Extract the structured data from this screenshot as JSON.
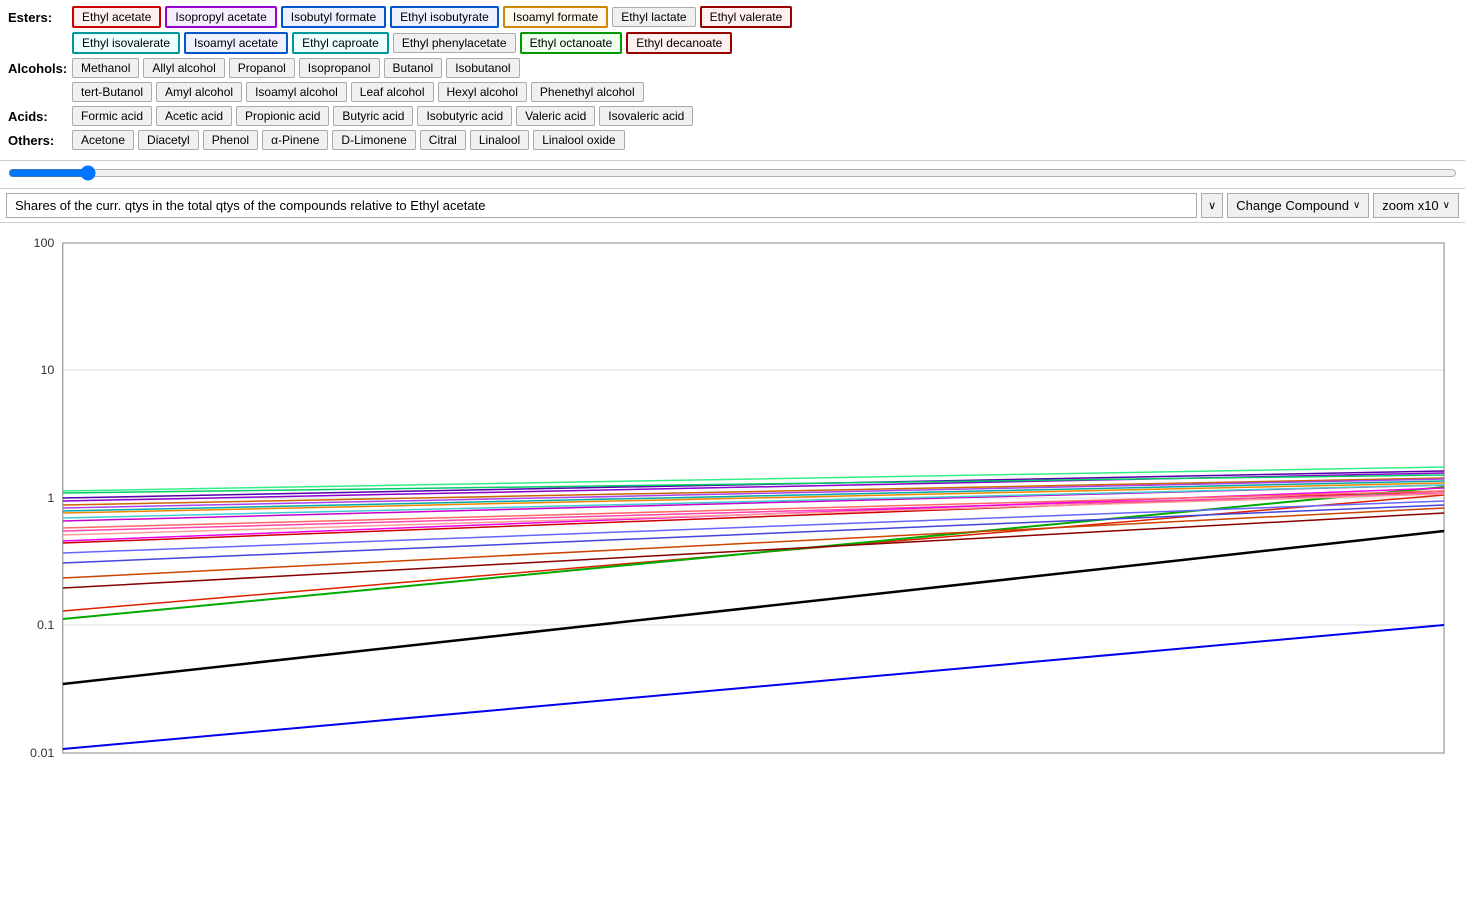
{
  "categories": [
    {
      "label": "Esters:",
      "compounds": [
        {
          "name": "Ethyl acetate",
          "style": "selected-red"
        },
        {
          "name": "Isopropyl acetate",
          "style": "selected-purple"
        },
        {
          "name": "Isobutyl formate",
          "style": "selected-blue"
        },
        {
          "name": "Ethyl isobutyrate",
          "style": "selected-blue"
        },
        {
          "name": "Isoamyl formate",
          "style": "selected-orange"
        },
        {
          "name": "Ethyl lactate",
          "style": ""
        },
        {
          "name": "Ethyl valerate",
          "style": "selected-darkred"
        }
      ]
    },
    {
      "label": "",
      "compounds": [
        {
          "name": "Ethyl isovalerate",
          "style": "selected-cyan"
        },
        {
          "name": "Isoamyl acetate",
          "style": "selected-blue"
        },
        {
          "name": "Ethyl caproate",
          "style": "selected-cyan"
        },
        {
          "name": "Ethyl phenylacetate",
          "style": ""
        },
        {
          "name": "Ethyl octanoate",
          "style": "selected-green"
        },
        {
          "name": "Ethyl decanoate",
          "style": "selected-darkred"
        }
      ]
    },
    {
      "label": "Alcohols:",
      "compounds": [
        {
          "name": "Methanol",
          "style": ""
        },
        {
          "name": "Allyl alcohol",
          "style": ""
        },
        {
          "name": "Propanol",
          "style": ""
        },
        {
          "name": "Isopropanol",
          "style": ""
        },
        {
          "name": "Butanol",
          "style": ""
        },
        {
          "name": "Isobutanol",
          "style": ""
        }
      ]
    },
    {
      "label": "",
      "compounds": [
        {
          "name": "tert-Butanol",
          "style": ""
        },
        {
          "name": "Amyl alcohol",
          "style": ""
        },
        {
          "name": "Isoamyl alcohol",
          "style": ""
        },
        {
          "name": "Leaf alcohol",
          "style": ""
        },
        {
          "name": "Hexyl alcohol",
          "style": ""
        },
        {
          "name": "Phenethyl alcohol",
          "style": ""
        }
      ]
    },
    {
      "label": "Acids:",
      "compounds": [
        {
          "name": "Formic acid",
          "style": ""
        },
        {
          "name": "Acetic acid",
          "style": ""
        },
        {
          "name": "Propionic acid",
          "style": ""
        },
        {
          "name": "Butyric acid",
          "style": ""
        },
        {
          "name": "Isobutyric acid",
          "style": ""
        },
        {
          "name": "Valeric acid",
          "style": ""
        },
        {
          "name": "Isovaleric acid",
          "style": ""
        }
      ]
    },
    {
      "label": "Others:",
      "compounds": [
        {
          "name": "Acetone",
          "style": ""
        },
        {
          "name": "Diacetyl",
          "style": ""
        },
        {
          "name": "Phenol",
          "style": ""
        },
        {
          "name": "α-Pinene",
          "style": ""
        },
        {
          "name": "D-Limonene",
          "style": ""
        },
        {
          "name": "Citral",
          "style": ""
        },
        {
          "name": "Linalool",
          "style": ""
        },
        {
          "name": "Linalool oxide",
          "style": ""
        }
      ]
    }
  ],
  "toolbar": {
    "description": "Shares of the curr. qtys in the total qtys of the compounds relative to Ethyl acetate",
    "change_compound_label": "Change Compound",
    "zoom_label": "zoom x10",
    "chevron": "∨"
  },
  "chart": {
    "y_labels": [
      "100",
      "10",
      "1",
      "0.1",
      "0.01"
    ],
    "title": ""
  }
}
